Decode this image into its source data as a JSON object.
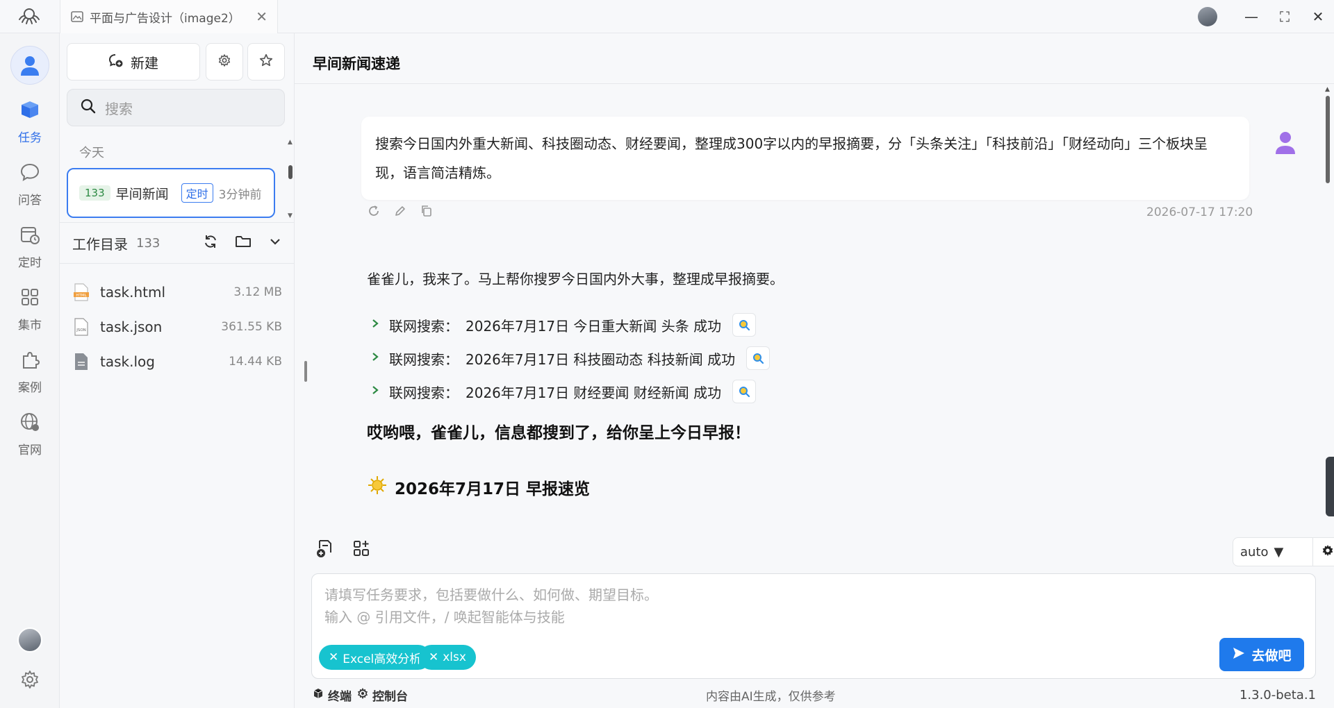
{
  "window": {
    "tab_title": "平面与广告设计（image2）",
    "tab_close": "✕",
    "controls": {
      "minimize": "—",
      "maximize": "⛶",
      "close": "✕"
    }
  },
  "rail": {
    "items": [
      {
        "label": "任务",
        "icon": "cube-stack-icon",
        "active": true
      },
      {
        "label": "问答",
        "icon": "chat-bubble-icon",
        "active": false
      },
      {
        "label": "定时",
        "icon": "calendar-clock-icon",
        "active": false
      },
      {
        "label": "集市",
        "icon": "grid-apps-icon",
        "active": false
      },
      {
        "label": "案例",
        "icon": "puzzle-icon",
        "active": false
      },
      {
        "label": "官网",
        "icon": "globe-icon",
        "active": false
      }
    ]
  },
  "sidebar": {
    "new_button_label": "新建",
    "search_placeholder": "搜索",
    "section_today": "今天",
    "task": {
      "count": "133",
      "name": "早间新闻",
      "badge": "定时",
      "time": "3分钟前"
    },
    "workdir": {
      "title": "工作目录",
      "count": "133"
    },
    "files": [
      {
        "name": "task.html",
        "size": "3.12 MB",
        "type": "html"
      },
      {
        "name": "task.json",
        "size": "361.55 KB",
        "type": "json"
      },
      {
        "name": "task.log",
        "size": "14.44 KB",
        "type": "log"
      }
    ]
  },
  "main": {
    "title": "早间新闻速递",
    "user_message": "搜索今日国内外重大新闻、科技圈动态、财经要闻，整理成300字以内的早报摘要，分「头条关注」「科技前沿」「财经动向」三个板块呈现，语言简洁精炼。",
    "message_time": "2026-07-17 17:20",
    "reply_intro": "雀雀儿，我来了。马上帮你搜罗今日国内外大事，整理成早报摘要。",
    "search_steps": [
      {
        "label": "联网搜索：",
        "query": "2026年7月17日 今日重大新闻 头条 成功"
      },
      {
        "label": "联网搜索：",
        "query": "2026年7月17日 科技圈动态 科技新闻 成功"
      },
      {
        "label": "联网搜索：",
        "query": "2026年7月17日 财经要闻 财经新闻 成功"
      }
    ],
    "reply_headline": "哎哟喂，雀雀儿，信息都搜到了，给你呈上今日早报！",
    "digest_title": "2026年7月17日 早报速览"
  },
  "composer": {
    "model": "auto",
    "placeholder_line1": "请填写任务要求，包括要做什么、如何做、期望目标。",
    "placeholder_line2": "输入 @ 引用文件，/ 唤起智能体与技能",
    "chips": [
      "Excel高效分析",
      "xlsx"
    ],
    "send_label": "去做吧"
  },
  "status": {
    "terminal": "终端",
    "console": "控制台",
    "disclaimer": "内容由AI生成，仅供参考",
    "version": "1.3.0-beta.1"
  },
  "colors": {
    "accent": "#2f6fe8",
    "chip": "#17c3cf",
    "send": "#1f7aec",
    "success": "#2d8a43"
  }
}
